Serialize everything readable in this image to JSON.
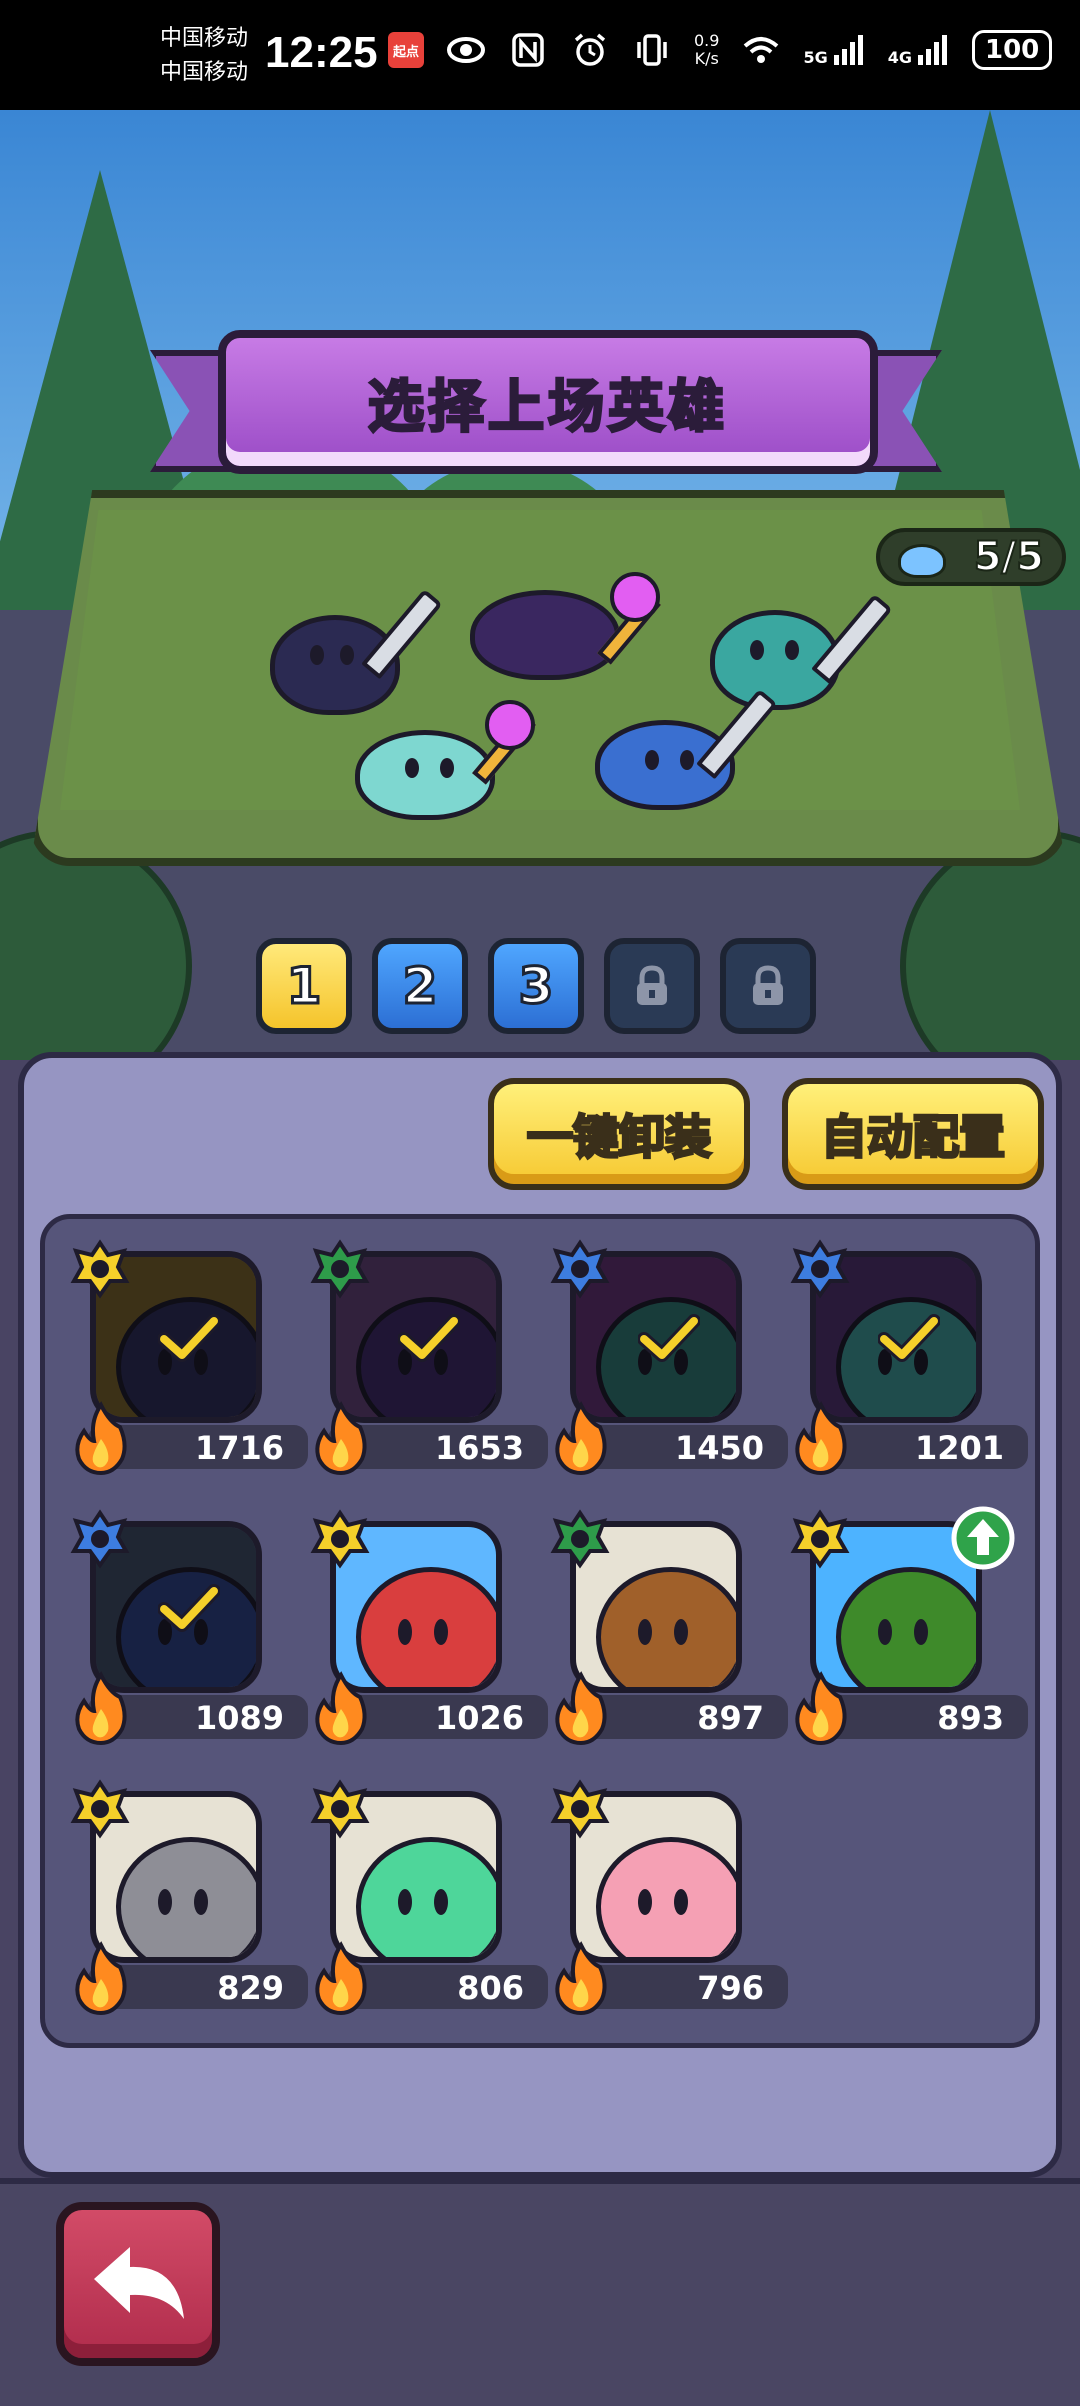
{
  "status_bar": {
    "carrier_1": "中国移动",
    "carrier_2": "中国移动",
    "time": "12:25",
    "app_badge": "起点",
    "net_speed_value": "0.9",
    "net_speed_unit": "K/s",
    "sim1_type": "5G",
    "sim2_type": "4G",
    "battery": "100"
  },
  "header": {
    "title": "选择上场英雄",
    "slots": "5/5"
  },
  "team_tabs": [
    {
      "label": "1",
      "state": "active"
    },
    {
      "label": "2",
      "state": "unlocked"
    },
    {
      "label": "3",
      "state": "unlocked"
    },
    {
      "label": "",
      "state": "locked"
    },
    {
      "label": "",
      "state": "locked"
    }
  ],
  "actions": {
    "unequip_all": "一键卸装",
    "auto_config": "自动配置"
  },
  "heroes": [
    {
      "power": "1716",
      "selected": true,
      "rank_color": "#f5d02a",
      "portrait_bg": "#6e5a2b",
      "body": "#2b2a52"
    },
    {
      "power": "1653",
      "selected": true,
      "rank_color": "#2e9c4a",
      "portrait_bg": "#5a3c6e",
      "body": "#3a2760"
    },
    {
      "power": "1450",
      "selected": true,
      "rank_color": "#3d7de0",
      "portrait_bg": "#5a2f6a",
      "body": "#2c6e6a"
    },
    {
      "power": "1201",
      "selected": true,
      "rank_color": "#3d7de0",
      "portrait_bg": "#4a2f66",
      "body": "#3a8a8a"
    },
    {
      "power": "1089",
      "selected": true,
      "rank_color": "#3d7de0",
      "portrait_bg": "#39465e",
      "body": "#2a3d7a"
    },
    {
      "power": "1026",
      "selected": false,
      "rank_color": "#f5d02a",
      "portrait_bg": "#5fb7ff",
      "body": "#d93e3e"
    },
    {
      "power": "897",
      "selected": false,
      "rank_color": "#2e9c4a",
      "portrait_bg": "#e7e2d4",
      "body": "#a0602a"
    },
    {
      "power": "893",
      "selected": false,
      "rank_color": "#f5d02a",
      "portrait_bg": "#4db3ff",
      "body": "#3e8a2a",
      "upgradable": true
    },
    {
      "power": "829",
      "selected": false,
      "rank_color": "#f5d02a",
      "portrait_bg": "#e7e2d4",
      "body": "#8e8e96"
    },
    {
      "power": "806",
      "selected": false,
      "rank_color": "#f5d02a",
      "portrait_bg": "#e7e2d4",
      "body": "#4ed69a"
    },
    {
      "power": "796",
      "selected": false,
      "rank_color": "#f5d02a",
      "portrait_bg": "#e7e2d4",
      "body": "#f5a0b4"
    }
  ],
  "colors": {
    "panel": "#9695c2",
    "grid": "#56557a",
    "accent_yellow": "#f6c830",
    "title_purple": "#b565db",
    "back_red": "#c23a59"
  }
}
